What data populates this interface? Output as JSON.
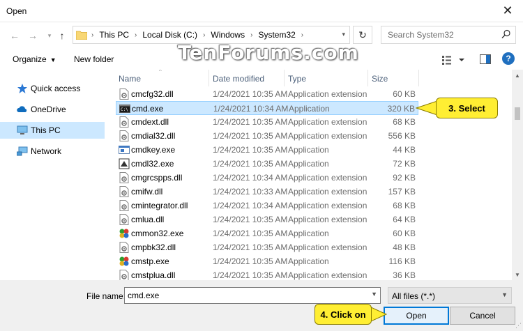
{
  "window": {
    "title": "Open"
  },
  "address": {
    "crumbs": [
      "This PC",
      "Local Disk (C:)",
      "Windows",
      "System32"
    ]
  },
  "search": {
    "placeholder": "Search System32"
  },
  "toolbar": {
    "organize": "Organize",
    "new_folder": "New folder"
  },
  "watermark": "TenForums.com",
  "nav": {
    "items": [
      {
        "label": "Quick access",
        "icon": "star-icon"
      },
      {
        "label": "OneDrive",
        "icon": "cloud-icon"
      },
      {
        "label": "This PC",
        "icon": "computer-icon",
        "selected": true
      },
      {
        "label": "Network",
        "icon": "network-icon"
      }
    ]
  },
  "columns": {
    "name": "Name",
    "date": "Date modified",
    "type": "Type",
    "size": "Size"
  },
  "files": [
    {
      "name": "cmcfg32.dll",
      "date": "1/24/2021 10:35 AM",
      "type": "Application extension",
      "size": "60 KB",
      "icon": "dll"
    },
    {
      "name": "cmd.exe",
      "date": "1/24/2021 10:34 AM",
      "type": "Application",
      "size": "320 KB",
      "icon": "cmd",
      "selected": true
    },
    {
      "name": "cmdext.dll",
      "date": "1/24/2021 10:35 AM",
      "type": "Application extension",
      "size": "68 KB",
      "icon": "dll"
    },
    {
      "name": "cmdial32.dll",
      "date": "1/24/2021 10:35 AM",
      "type": "Application extension",
      "size": "556 KB",
      "icon": "dll"
    },
    {
      "name": "cmdkey.exe",
      "date": "1/24/2021 10:35 AM",
      "type": "Application",
      "size": "44 KB",
      "icon": "exe"
    },
    {
      "name": "cmdl32.exe",
      "date": "1/24/2021 10:35 AM",
      "type": "Application",
      "size": "72 KB",
      "icon": "exe2"
    },
    {
      "name": "cmgrcspps.dll",
      "date": "1/24/2021 10:34 AM",
      "type": "Application extension",
      "size": "92 KB",
      "icon": "dll"
    },
    {
      "name": "cmifw.dll",
      "date": "1/24/2021 10:33 AM",
      "type": "Application extension",
      "size": "157 KB",
      "icon": "dll"
    },
    {
      "name": "cmintegrator.dll",
      "date": "1/24/2021 10:34 AM",
      "type": "Application extension",
      "size": "68 KB",
      "icon": "dll"
    },
    {
      "name": "cmlua.dll",
      "date": "1/24/2021 10:35 AM",
      "type": "Application extension",
      "size": "64 KB",
      "icon": "dll"
    },
    {
      "name": "cmmon32.exe",
      "date": "1/24/2021 10:35 AM",
      "type": "Application",
      "size": "60 KB",
      "icon": "exe3"
    },
    {
      "name": "cmpbk32.dll",
      "date": "1/24/2021 10:35 AM",
      "type": "Application extension",
      "size": "48 KB",
      "icon": "dll"
    },
    {
      "name": "cmstp.exe",
      "date": "1/24/2021 10:35 AM",
      "type": "Application",
      "size": "116 KB",
      "icon": "exe3"
    },
    {
      "name": "cmstplua.dll",
      "date": "1/24/2021 10:35 AM",
      "type": "Application extension",
      "size": "36 KB",
      "icon": "dll"
    }
  ],
  "bottom": {
    "file_name_label": "File name:",
    "file_name_value": "cmd.exe",
    "file_type": "All files (*.*)",
    "open": "Open",
    "cancel": "Cancel"
  },
  "callouts": {
    "select": "3. Select",
    "click_on": "4. Click on"
  },
  "colors": {
    "accent": "#0078d7",
    "selection": "#cce8ff",
    "callout": "#ffee33"
  }
}
